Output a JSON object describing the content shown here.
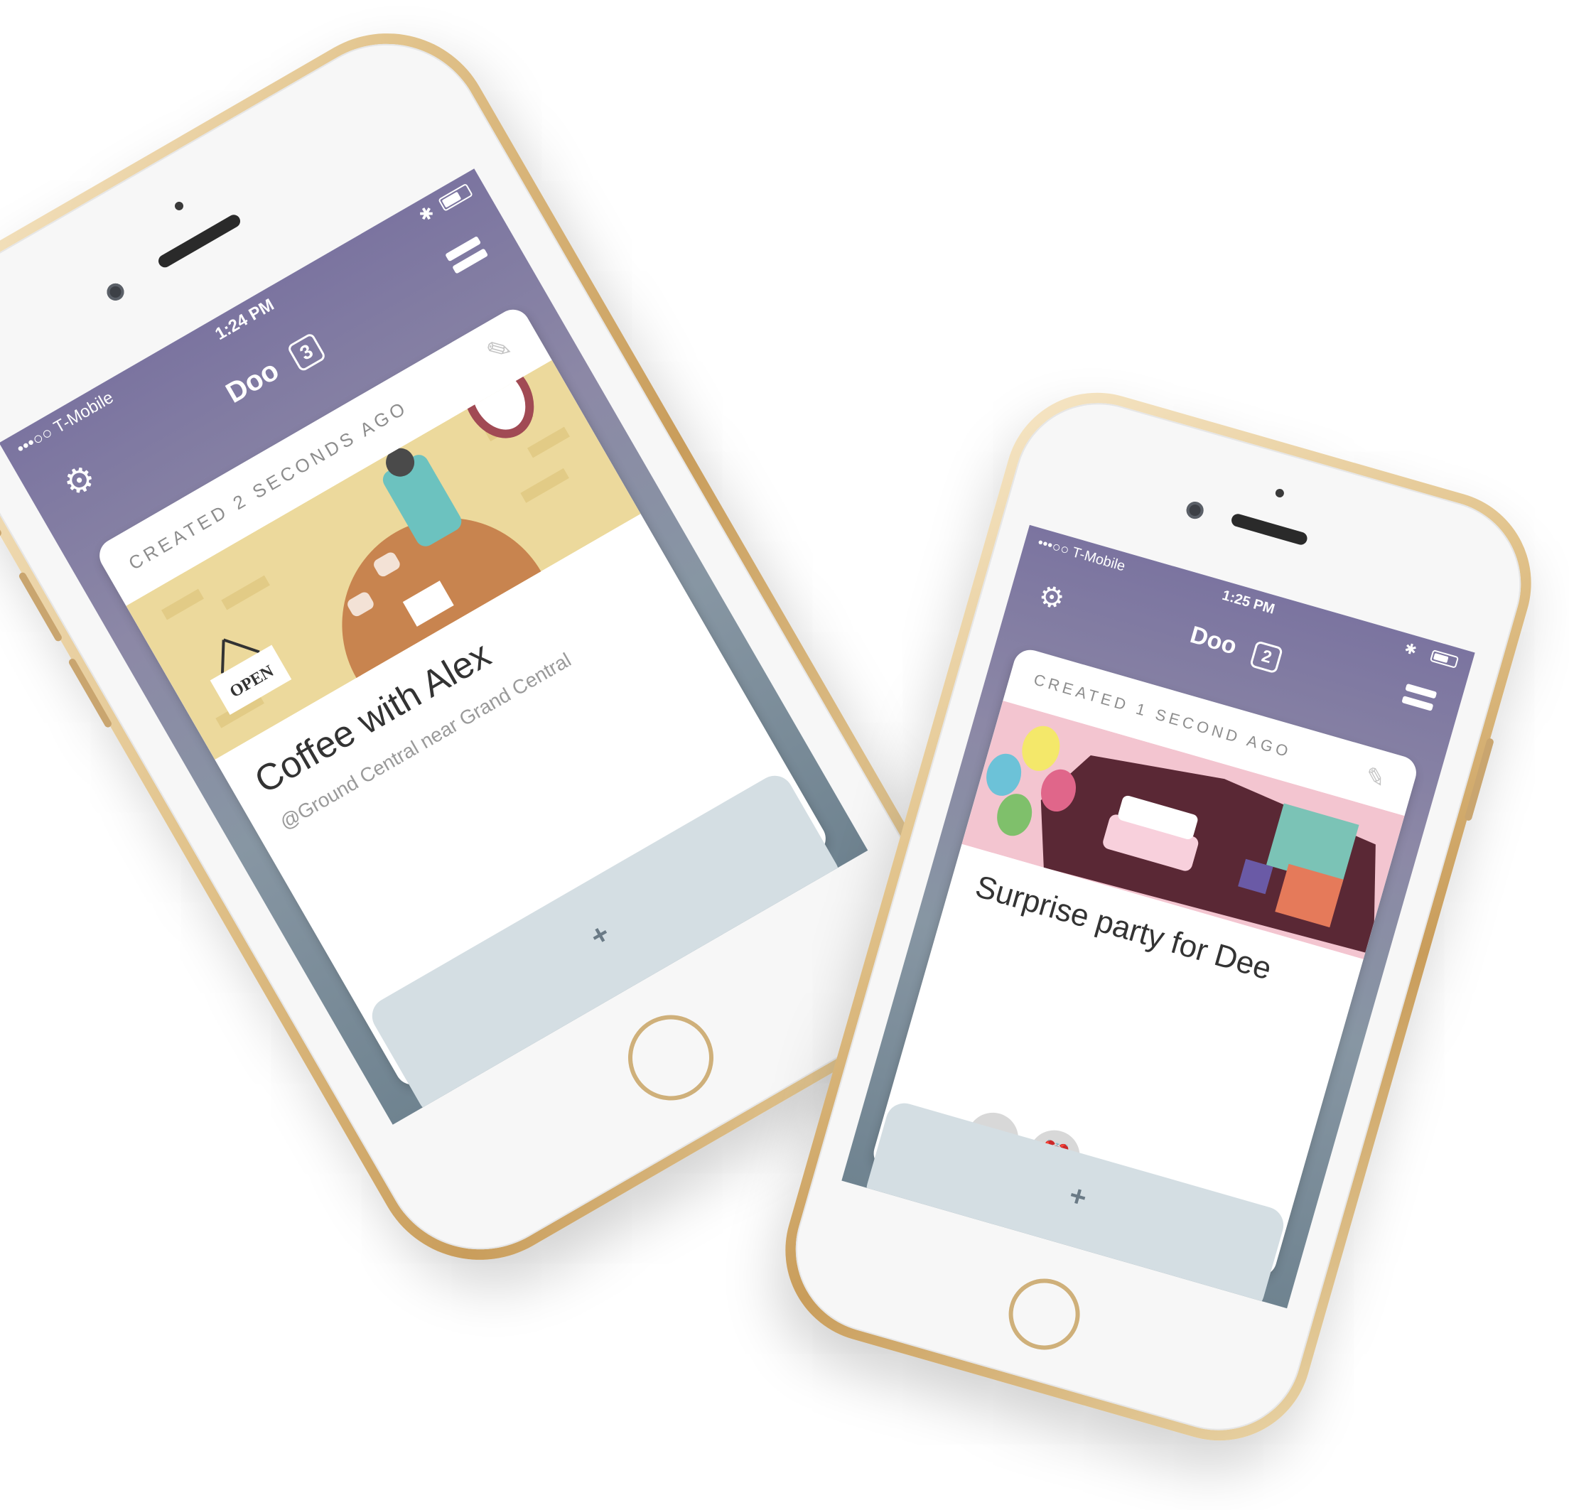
{
  "phones": [
    {
      "status": {
        "carrier": "•••○○ T-Mobile",
        "time": "1:24 PM"
      },
      "nav": {
        "title": "Doo",
        "count": "3"
      },
      "card": {
        "meta": "CREATED 2 SECONDS AGO",
        "title": "Coffee with Alex",
        "subtitle": "@Ground Central near Grand Central",
        "sign_text": "OPEN"
      },
      "add_label": "+"
    },
    {
      "status": {
        "carrier": "•••○○ T-Mobile",
        "time": "1:25 PM"
      },
      "nav": {
        "title": "Doo",
        "count": "2"
      },
      "card": {
        "meta": "CREATED 1 SECOND AGO",
        "title": "Surprise party for Dee"
      },
      "add_label": "+"
    }
  ],
  "icons": {
    "settings": "gear-icon",
    "menu": "menu-icon",
    "edit": "edit-icon",
    "done": "check-icon",
    "snooze": "alarm-clock-icon",
    "add": "plus-icon"
  },
  "colors": {
    "header_purple": "#7b74a0",
    "screen_gray": "#6f8390",
    "gold": "#c99d5b",
    "illustration_yellow": "#ecd99c",
    "illustration_pink": "#f3c5d0",
    "illustration_maroon": "#5a2835"
  }
}
